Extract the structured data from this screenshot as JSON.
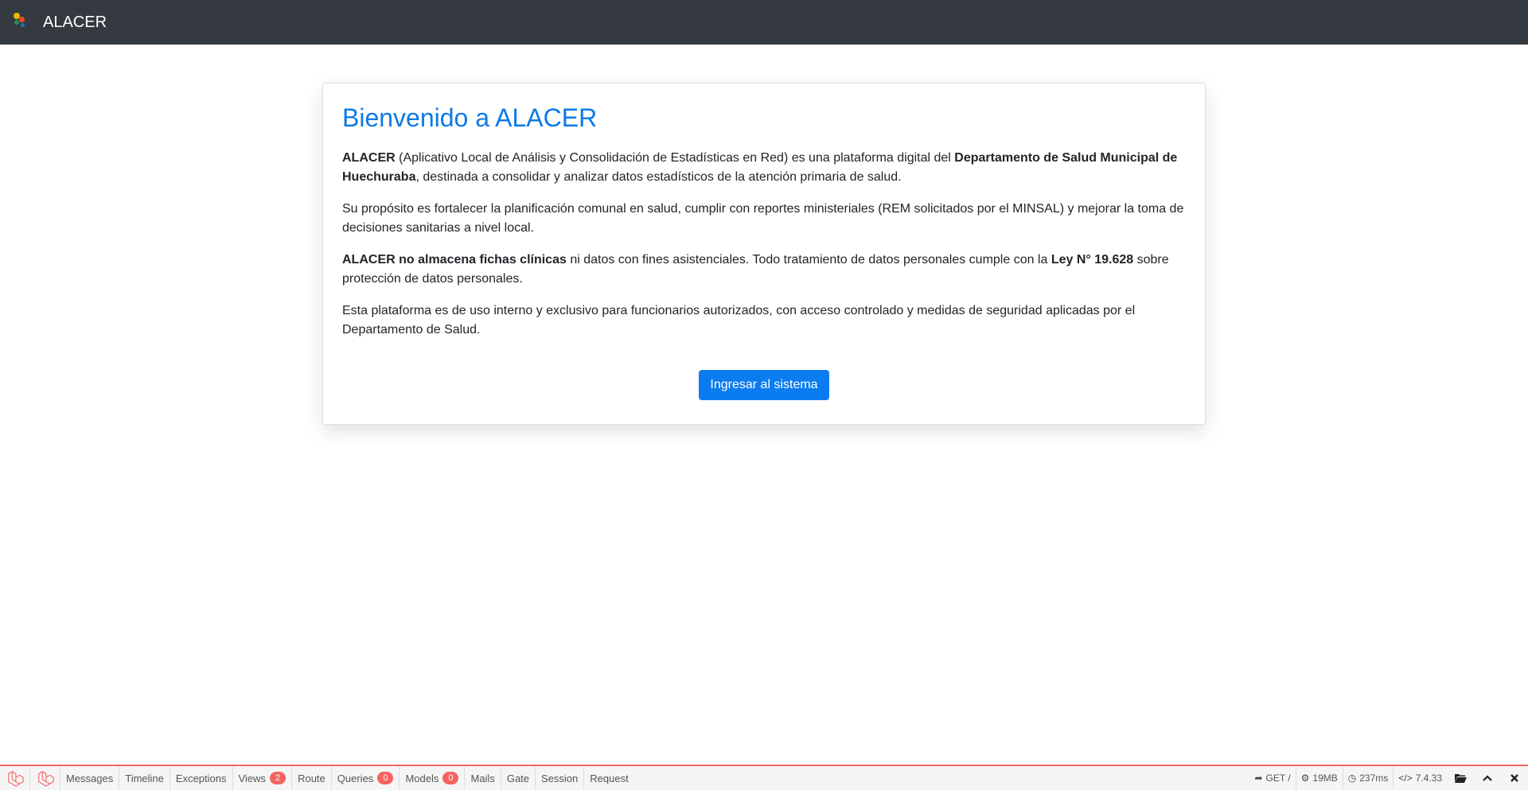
{
  "navbar": {
    "brand_name": "ALACER",
    "logo_text": "ALACER"
  },
  "card": {
    "title": "Bienvenido a ALACER",
    "p1": {
      "b1": "ALACER",
      "t1": " (Aplicativo Local de Análisis y Consolidación de Estadísticas en Red) es una plataforma digital del ",
      "b2": "Departamento de Salud Municipal de Huechuraba",
      "t2": ", destinada a consolidar y analizar datos estadísticos de la atención primaria de salud."
    },
    "p2": "Su propósito es fortalecer la planificación comunal en salud, cumplir con reportes ministeriales (REM solicitados por el MINSAL) y mejorar la toma de decisiones sanitarias a nivel local.",
    "p3": {
      "b1": "ALACER no almacena fichas clínicas",
      "t1": " ni datos con fines asistenciales. Todo tratamiento de datos personales cumple con la ",
      "b2": "Ley N° 19.628",
      "t2": " sobre protección de datos personales."
    },
    "p4": "Esta plataforma es de uso interno y exclusivo para funcionarios autorizados, con acceso controlado y medidas de seguridad aplicadas por el Departamento de Salud.",
    "button_label": "Ingresar al sistema"
  },
  "debugbar": {
    "tabs": {
      "messages": "Messages",
      "timeline": "Timeline",
      "exceptions": "Exceptions",
      "views": "Views",
      "views_count": "2",
      "route": "Route",
      "queries": "Queries",
      "queries_count": "0",
      "models": "Models",
      "models_count": "0",
      "mails": "Mails",
      "gate": "Gate",
      "session": "Session",
      "request": "Request"
    },
    "status": {
      "method": "GET /",
      "memory": "19MB",
      "time": "237ms",
      "php_version": "7.4.33"
    },
    "icons": {
      "route": "share-icon",
      "memory": "cogs-icon",
      "time": "clock-icon",
      "php": "code-icon",
      "open": "folder-open-icon",
      "minimize": "chevron-up-icon",
      "close": "close-icon"
    },
    "accent_color": "#f4645f"
  },
  "colors": {
    "navbar_bg": "#343a40",
    "title": "#0a7ae6",
    "button": "#0a7cf0"
  }
}
